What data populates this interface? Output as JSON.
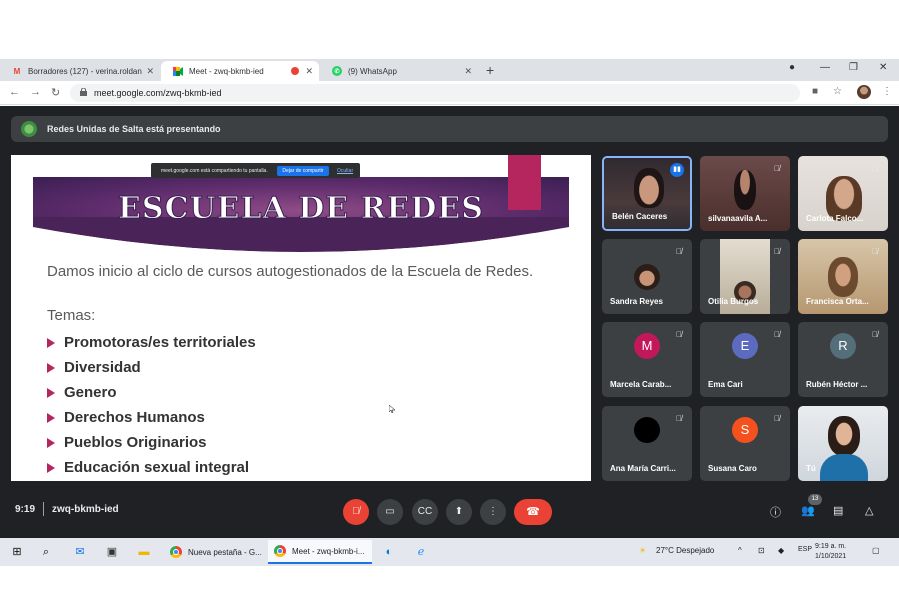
{
  "browser": {
    "tabs": [
      {
        "label": "Borradores (127) - verina.roldan",
        "icon": "gmail-icon",
        "active": false
      },
      {
        "label": "Meet - zwq-bkmb-ied",
        "icon": "meet-icon",
        "active": true
      },
      {
        "label": "(9) WhatsApp",
        "icon": "whatsapp-icon",
        "active": false
      }
    ],
    "url": "meet.google.com/zwq-bkmb-ied"
  },
  "meet": {
    "presenting_text": "Redes Unidas de Salta está presentando",
    "share_bar": {
      "text": "meet.google.com está compartiendo tu pantalla.",
      "stop_label": "Dejar de compartir",
      "hide_label": "Ocultar"
    },
    "slide": {
      "title": "ESCUELA DE REDES",
      "intro": "Damos inicio al ciclo de cursos autogestionados de la Escuela de Redes.",
      "temas_label": "Temas:",
      "bullets": [
        "Promotoras/es territoriales",
        "Diversidad",
        "Genero",
        "Derechos Humanos",
        "Pueblos Originarios",
        "Educación sexual integral"
      ]
    },
    "participants": [
      {
        "name": "Belén Caceres",
        "type": "video",
        "speaking": true
      },
      {
        "name": "silvanaavila A...",
        "type": "video",
        "muted": true
      },
      {
        "name": "Carlota Falco...",
        "type": "video",
        "muted": true
      },
      {
        "name": "Sandra Reyes",
        "type": "photo",
        "muted": true
      },
      {
        "name": "Otilia Burgos",
        "type": "video",
        "muted": true
      },
      {
        "name": "Francisca Orta...",
        "type": "video",
        "muted": true
      },
      {
        "name": "Marcela Carab...",
        "initial": "M",
        "color": "#c2185b",
        "muted": true
      },
      {
        "name": "Ema Cari",
        "initial": "E",
        "color": "#5c6bc0",
        "muted": true
      },
      {
        "name": "Rubén Héctor ...",
        "initial": "R",
        "color": "#546e7a",
        "muted": true
      },
      {
        "name": "Ana María Carri...",
        "initial": "",
        "color": "#000000",
        "muted": true
      },
      {
        "name": "Susana Caro",
        "initial": "S",
        "color": "#f4511e",
        "muted": true
      },
      {
        "name": "Tú",
        "type": "video",
        "muted": true
      }
    ],
    "bottom": {
      "time": "9:19",
      "meeting_code": "zwq-bkmb-ied",
      "participants_count": "13"
    }
  },
  "taskbar": {
    "apps": [
      {
        "label": "Nueva pestaña - G..."
      },
      {
        "label": "Meet - zwq-bkmb-i..."
      }
    ],
    "weather": "27°C  Despejado",
    "lang": "ESP",
    "time": "9:19 a. m.",
    "date": "1/10/2021"
  },
  "colors": {
    "meet_bg": "#202124",
    "accent_pink": "#b5265f",
    "banner_purple": "#5e2c6c",
    "hangup_red": "#ea4335"
  }
}
